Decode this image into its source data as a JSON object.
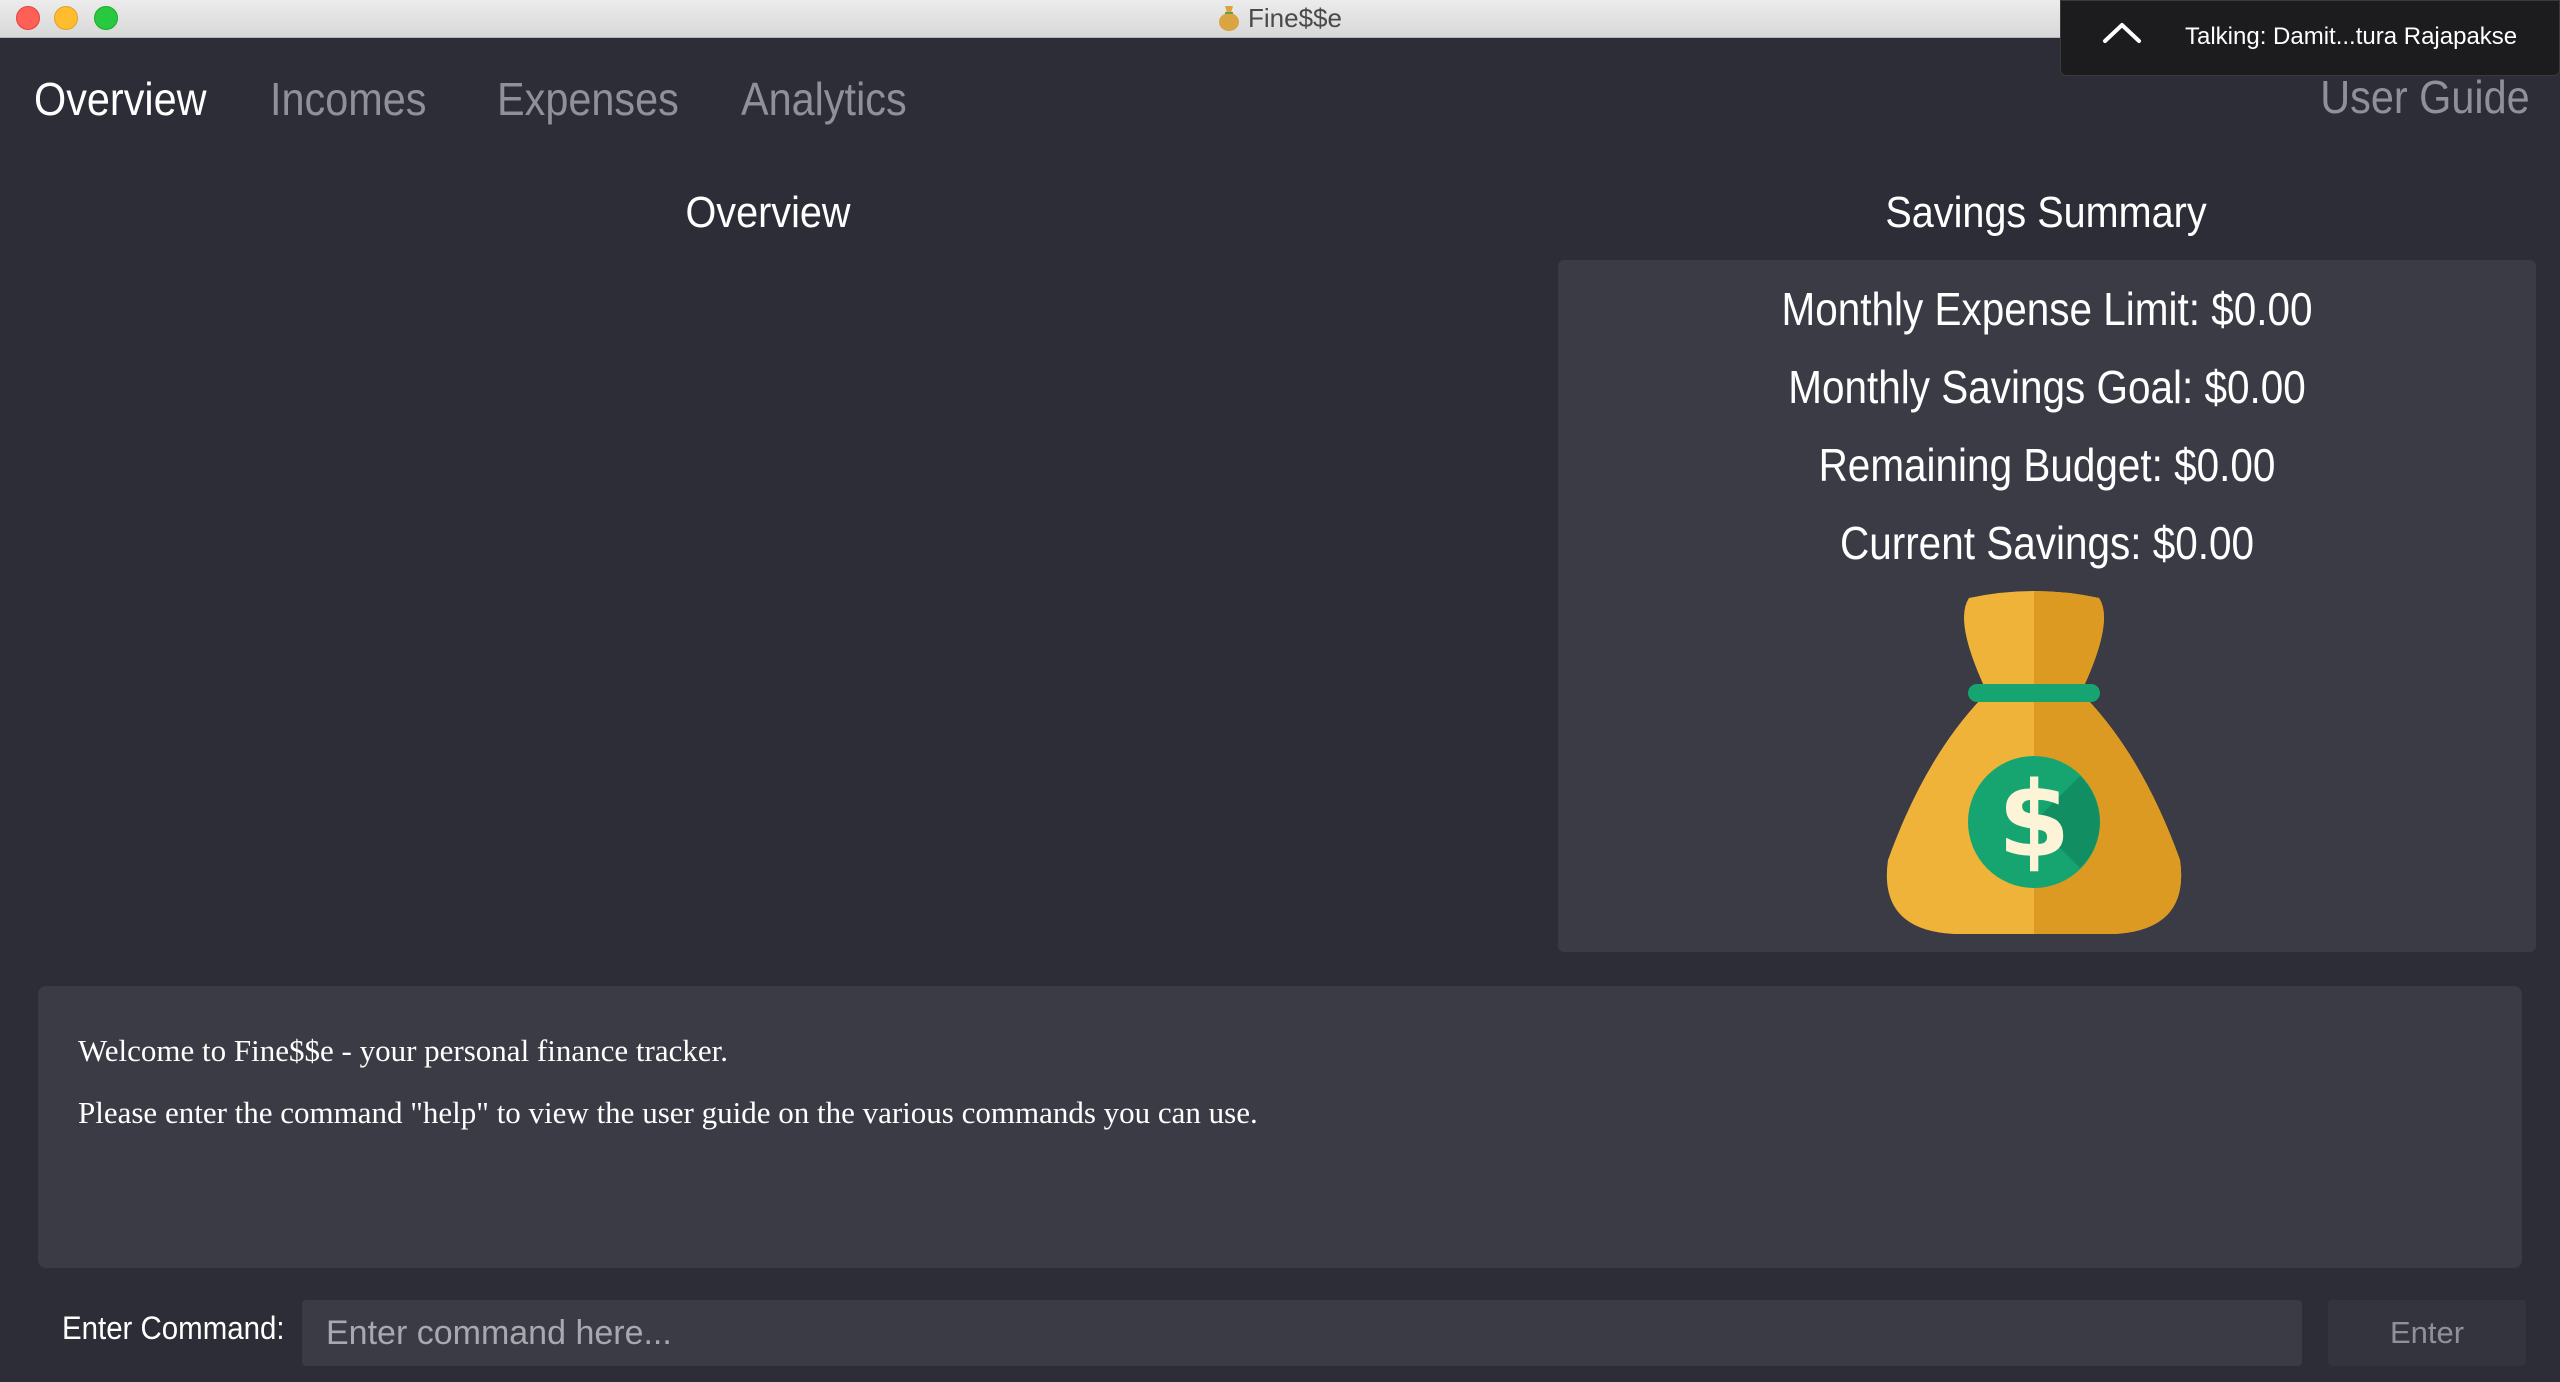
{
  "window": {
    "title": "Fine$$e",
    "app_icon": "money-bag-icon"
  },
  "talking_overlay": {
    "text": "Talking: Damit...tura Rajapakse",
    "icon": "chevron-up-icon"
  },
  "nav": {
    "tabs": [
      {
        "label": "Overview",
        "active": true
      },
      {
        "label": "Incomes",
        "active": false
      },
      {
        "label": "Expenses",
        "active": false
      },
      {
        "label": "Analytics",
        "active": false
      }
    ],
    "user_guide": "User Guide"
  },
  "overview": {
    "title": "Overview"
  },
  "savings_summary": {
    "title": "Savings Summary",
    "lines": [
      "Monthly Expense Limit: $0.00",
      "Monthly Savings Goal: $0.00",
      "Remaining Budget: $0.00",
      "Current Savings: $0.00"
    ],
    "image": "money-bag-icon",
    "colors": {
      "bag": "#f0b33a",
      "bag_shade": "#dc9a22",
      "tie": "#16a571",
      "coin": "#16a571"
    }
  },
  "result_display": {
    "lines": [
      "Welcome to Fine$$e - your personal finance tracker.",
      "Please enter the command \"help\" to view the user guide on the various commands you can use."
    ]
  },
  "command_bar": {
    "label": "Enter Command:",
    "placeholder": "Enter command here...",
    "value": "",
    "button": "Enter"
  },
  "colors": {
    "background": "#2c2d36",
    "panel": "#3a3b45",
    "text": "#ffffff",
    "muted_text": "#8f9099"
  }
}
